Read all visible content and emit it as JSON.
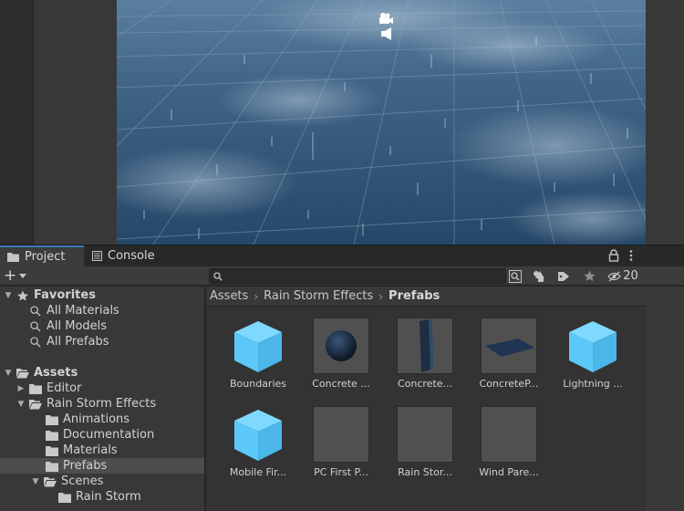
{
  "tabs": [
    {
      "label": "Project"
    },
    {
      "label": "Console"
    }
  ],
  "toolbar": {
    "add_label": "+",
    "search_placeholder": "",
    "hidden_count": "20"
  },
  "tree": {
    "favorites_label": "Favorites",
    "favorites": [
      "All Materials",
      "All Models",
      "All Prefabs"
    ],
    "assets_label": "Assets",
    "editor_label": "Editor",
    "rain_label": "Rain Storm Effects",
    "rain_children": [
      "Animations",
      "Documentation",
      "Materials",
      "Prefabs"
    ],
    "scenes_label": "Scenes",
    "scenes_child": "Rain Storm"
  },
  "breadcrumb": [
    "Assets",
    "Rain Storm Effects",
    "Prefabs"
  ],
  "assets": [
    {
      "name": "Boundaries",
      "icon": "prefab-cube-icon"
    },
    {
      "name": "Concrete ...",
      "icon": "sphere-thumbnail"
    },
    {
      "name": "Concrete...",
      "icon": "pillar-thumbnail"
    },
    {
      "name": "ConcreteP...",
      "icon": "plane-thumbnail"
    },
    {
      "name": "Lightning ...",
      "icon": "prefab-cube-icon"
    },
    {
      "name": "Mobile Fir...",
      "icon": "prefab-cube-icon"
    },
    {
      "name": "PC First P...",
      "icon": "empty-thumbnail"
    },
    {
      "name": "Rain Stor...",
      "icon": "empty-thumbnail"
    },
    {
      "name": "Wind Pare...",
      "icon": "empty-thumbnail"
    }
  ],
  "colors": {
    "accent": "#3a79bb",
    "prefab_cube": "#5cc8f8",
    "viewport_sky": "#36597a"
  }
}
